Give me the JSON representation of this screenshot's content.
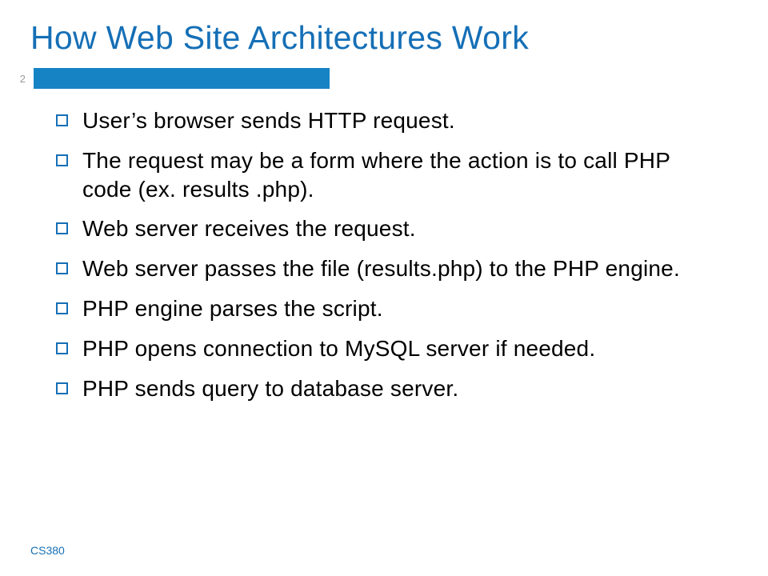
{
  "slide": {
    "title": "How Web Site Architectures Work",
    "number": "2",
    "footer": "CS380",
    "bullets": [
      "User’s browser sends HTTP request.",
      "The request may be a form where the action is to call PHP code (ex. results .php).",
      "Web server receives the request.",
      "Web server passes the file (results.php) to the PHP engine.",
      "PHP engine parses the script.",
      "PHP opens connection to MySQL server if needed.",
      "PHP sends query to database server."
    ]
  }
}
